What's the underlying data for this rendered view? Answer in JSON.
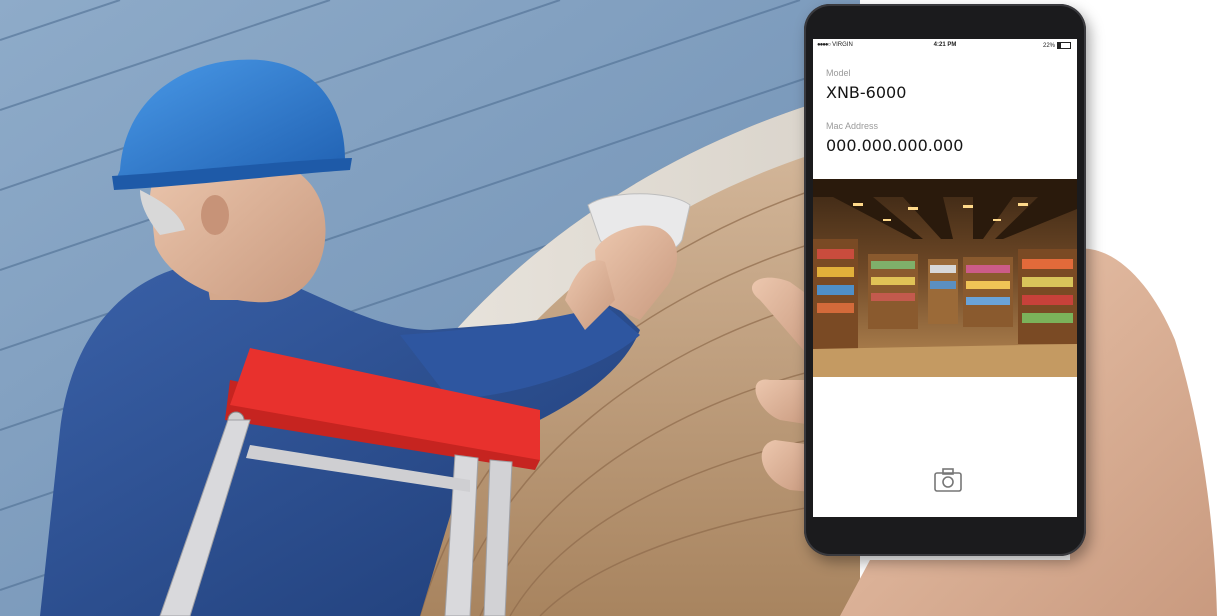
{
  "phone": {
    "status_bar": {
      "carrier": "VIRGIN",
      "time": "4:21 PM",
      "battery": "22%"
    },
    "model_label": "Model",
    "model_value": "XNB-6000",
    "mac_label": "Mac Address",
    "mac_value": "000.000.000.000",
    "camera_button_icon": "camera-icon"
  },
  "colors": {
    "helmet": "#2f7fd6",
    "jacket": "#2b4f93",
    "ladder_top": "#e8312d",
    "wall": "#7f9fc0",
    "brick": "#c9a98a"
  }
}
